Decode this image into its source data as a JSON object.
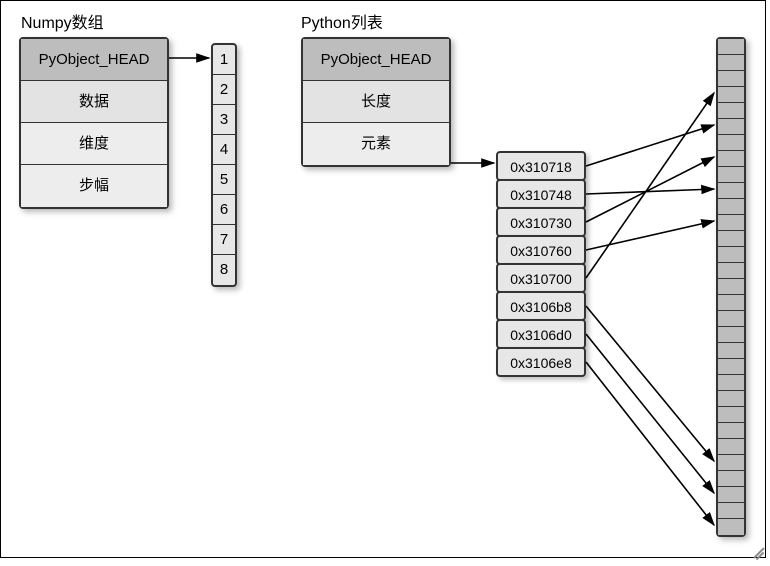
{
  "titles": {
    "numpy": "Numpy数组",
    "pylist": "Python列表"
  },
  "numpy_struct": {
    "head": "PyObject_HEAD",
    "data": "数据",
    "dims": "维度",
    "strides": "步幅"
  },
  "pylist_struct": {
    "head": "PyObject_HEAD",
    "length": "长度",
    "items": "元素"
  },
  "contiguous_values": [
    "1",
    "2",
    "3",
    "4",
    "5",
    "6",
    "7",
    "8"
  ],
  "addresses": [
    "0x310718",
    "0x310748",
    "0x310730",
    "0x310760",
    "0x310700",
    "0x3106b8",
    "0x3106d0",
    "0x3106e8"
  ],
  "memory_cells": 31,
  "pointer_targets": [
    5,
    9,
    7,
    11,
    3,
    26,
    28,
    30
  ]
}
